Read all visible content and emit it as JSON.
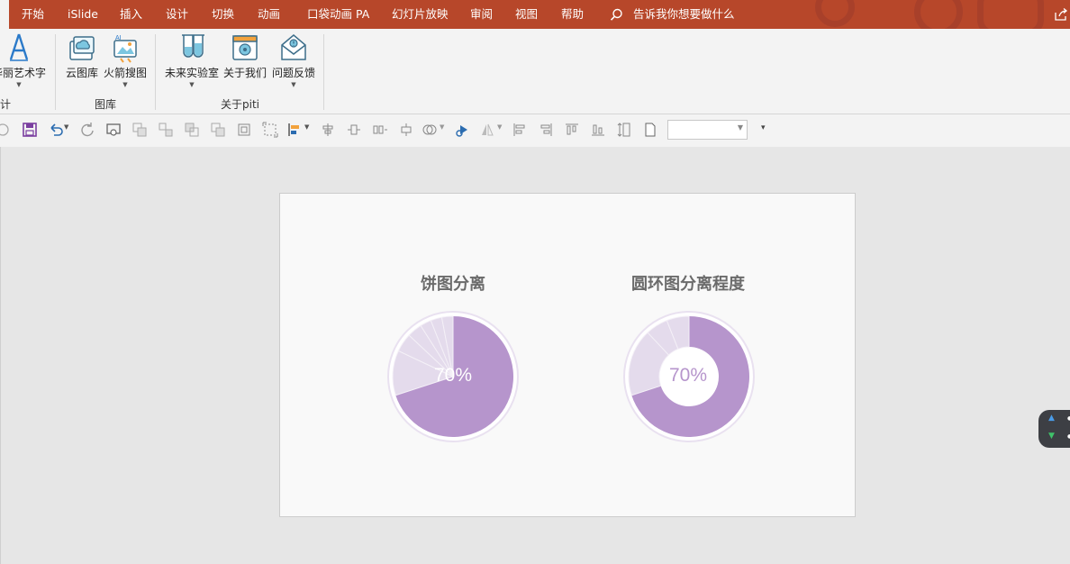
{
  "menu": {
    "items": [
      "开始",
      "iSlide",
      "插入",
      "设计",
      "切换",
      "动画",
      "口袋动画 PA",
      "幻灯片放映",
      "审阅",
      "视图",
      "帮助"
    ],
    "search_text": "告诉我你想要做什么"
  },
  "ribbon": {
    "buttons": [
      {
        "label": "华丽艺术字",
        "icon": "art-text-icon",
        "has_dropdown": true
      },
      {
        "label": "云图库",
        "icon": "cloud-gallery-icon",
        "has_dropdown": false
      },
      {
        "label": "火箭搜图",
        "icon": "rocket-search-icon",
        "has_dropdown": true
      },
      {
        "label": "未来实验室",
        "icon": "lab-flask-icon",
        "has_dropdown": true
      },
      {
        "label": "关于我们",
        "icon": "about-us-icon",
        "has_dropdown": false
      },
      {
        "label": "问题反馈",
        "icon": "feedback-mail-icon",
        "has_dropdown": true
      }
    ],
    "groups": [
      "计",
      "图库",
      "关于piti"
    ]
  },
  "toolbar": {
    "size_value": ""
  },
  "slide": {
    "charts": [
      {
        "title": "饼图分离",
        "label": "70%",
        "type": "pie",
        "slices": [
          70,
          12,
          5,
          4,
          3,
          3,
          3
        ]
      },
      {
        "title": "圆环图分离程度",
        "label": "70%",
        "type": "donut",
        "slices": [
          70,
          18,
          6,
          6
        ]
      }
    ],
    "colors": {
      "main": "#b695cc",
      "light": "#e4dbec",
      "ring": "#e9e1f0",
      "label_pie": "#ffffff",
      "label_donut": "#b695cc"
    }
  }
}
